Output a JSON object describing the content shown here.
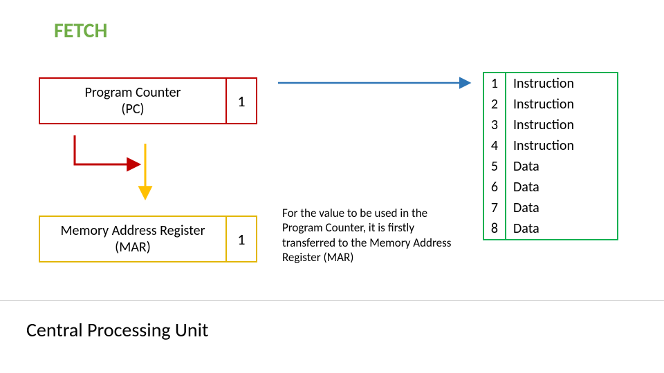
{
  "title": "FETCH",
  "pc": {
    "label": "Program Counter\n(PC)",
    "value": "1"
  },
  "mar": {
    "label": "Memory Address Register\n(MAR)",
    "value": "1"
  },
  "description": "For the value to be used in the Program Counter, it is firstly transferred to the Memory Address Register (MAR)",
  "memory": [
    {
      "addr": "1",
      "content": "Instruction"
    },
    {
      "addr": "2",
      "content": "Instruction"
    },
    {
      "addr": "3",
      "content": "Instruction"
    },
    {
      "addr": "4",
      "content": "Instruction"
    },
    {
      "addr": "5",
      "content": "Data"
    },
    {
      "addr": "6",
      "content": "Data"
    },
    {
      "addr": "7",
      "content": "Data"
    },
    {
      "addr": "8",
      "content": "Data"
    }
  ],
  "footer": "Central Processing Unit",
  "colors": {
    "title": "#70ad47",
    "pc_border": "#c00000",
    "mar_border": "#e2b600",
    "mem_border": "#00b050",
    "arrow_red": "#c00000",
    "arrow_yellow": "#ffc000",
    "arrow_blue": "#2e75b6"
  }
}
